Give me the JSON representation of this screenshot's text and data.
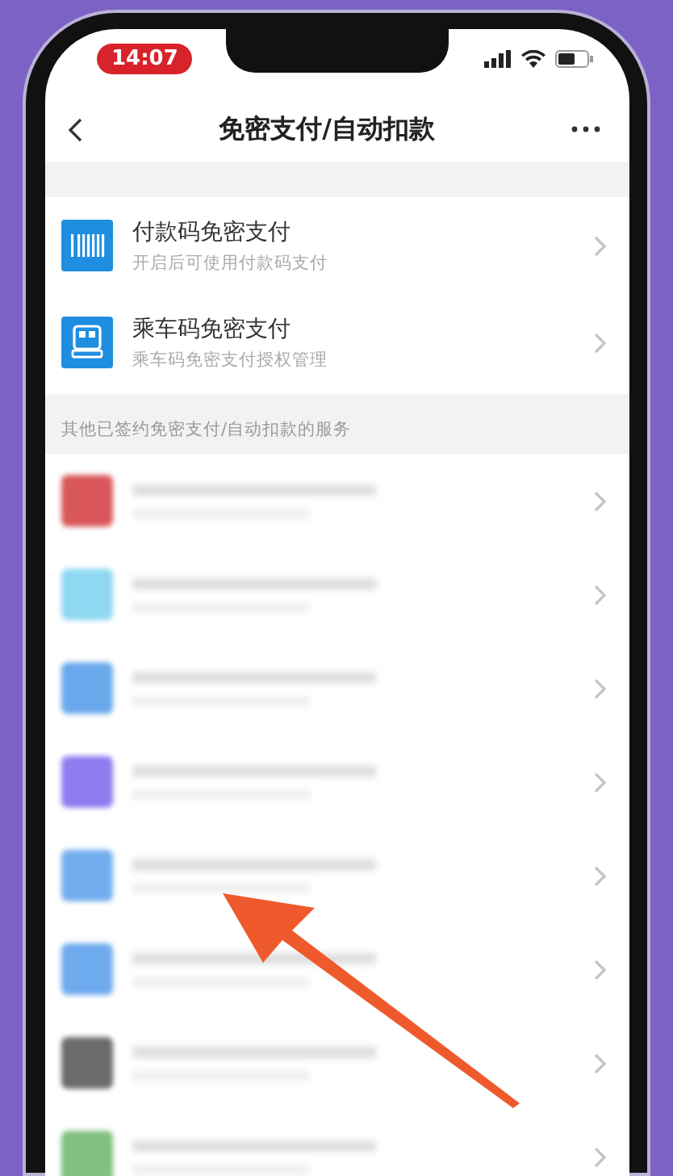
{
  "status_bar": {
    "time": "14:07"
  },
  "nav": {
    "title": "免密支付/自动扣款"
  },
  "services": [
    {
      "kind": "barcode",
      "title": "付款码免密支付",
      "subtitle": "开启后可使用付款码支付"
    },
    {
      "kind": "transit",
      "title": "乘车码免密支付",
      "subtitle": "乘车码免密支付授权管理"
    }
  ],
  "section_header": "其他已签约免密支付/自动扣款的服务",
  "blurred_services": [
    {
      "color": "#d9575a"
    },
    {
      "color": "#8fd8f2"
    },
    {
      "color": "#6aa8ec"
    },
    {
      "color": "#8e7cf0"
    },
    {
      "color": "#72aeee"
    },
    {
      "color": "#6eaaee"
    },
    {
      "color": "#6b6b6b"
    },
    {
      "color": "#7fbf7f"
    }
  ]
}
